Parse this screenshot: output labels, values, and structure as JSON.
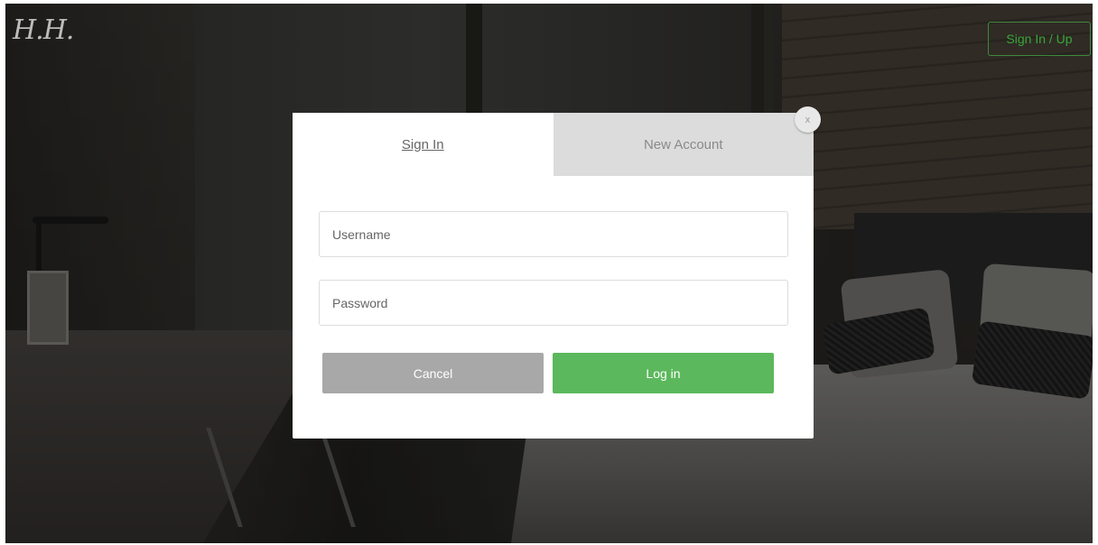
{
  "header": {
    "logo": "H.H.",
    "sign_in_up_label": "Sign In / Up"
  },
  "modal": {
    "tabs": [
      {
        "label": "Sign In",
        "active": true
      },
      {
        "label": "New Account",
        "active": false
      }
    ],
    "close_label": "x",
    "username": {
      "placeholder": "Username",
      "value": ""
    },
    "password": {
      "placeholder": "Password",
      "value": ""
    },
    "cancel_label": "Cancel",
    "login_label": "Log in"
  },
  "colors": {
    "accent_green": "#5cb85c",
    "header_button_green": "#3aa53a",
    "cancel_gray": "#a8a8a8",
    "inactive_tab": "#dcdcdc"
  }
}
